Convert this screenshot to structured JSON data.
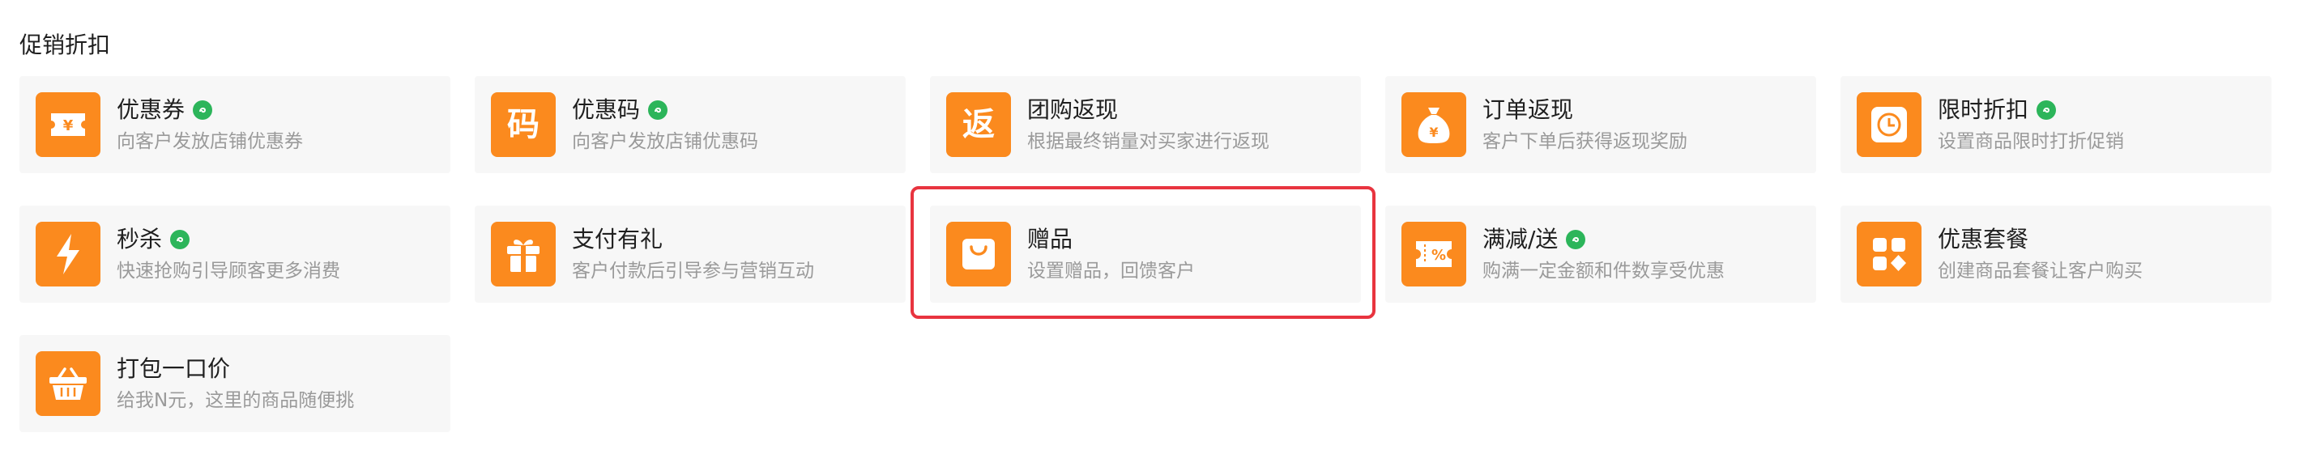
{
  "section": {
    "title": "促销折扣"
  },
  "colors": {
    "accent": "#fb8a1e",
    "miniprogram_badge": "#2cb55a",
    "highlight_border": "#e8343f",
    "card_bg": "#f7f7f7"
  },
  "cards": [
    {
      "title": "优惠券",
      "desc": "向客户发放店铺优惠券",
      "icon": "coupon-icon",
      "badge": true
    },
    {
      "title": "优惠码",
      "desc": "向客户发放店铺优惠码",
      "icon": "code-icon",
      "glyph": "码",
      "badge": true
    },
    {
      "title": "团购返现",
      "desc": "根据最终销量对买家进行返现",
      "icon": "return-icon",
      "glyph": "返",
      "badge": false
    },
    {
      "title": "订单返现",
      "desc": "客户下单后获得返现奖励",
      "icon": "money-bag-icon",
      "badge": false
    },
    {
      "title": "限时折扣",
      "desc": "设置商品限时打折促销",
      "icon": "clock-icon",
      "badge": true
    },
    {
      "title": "秒杀",
      "desc": "快速抢购引导顾客更多消费",
      "icon": "lightning-icon",
      "badge": true
    },
    {
      "title": "支付有礼",
      "desc": "客户付款后引导参与营销互动",
      "icon": "gift-icon",
      "badge": false
    },
    {
      "title": "赠品",
      "desc": "设置赠品，回馈客户",
      "icon": "shopping-bag-icon",
      "badge": false,
      "highlighted": true
    },
    {
      "title": "满减/送",
      "desc": "购满一定金额和件数享受优惠",
      "icon": "discount-ticket-icon",
      "badge": true
    },
    {
      "title": "优惠套餐",
      "desc": "创建商品套餐让客户购买",
      "icon": "package-icon",
      "badge": false
    },
    {
      "title": "打包一口价",
      "desc": "给我N元，这里的商品随便挑",
      "icon": "basket-icon",
      "badge": false
    }
  ]
}
